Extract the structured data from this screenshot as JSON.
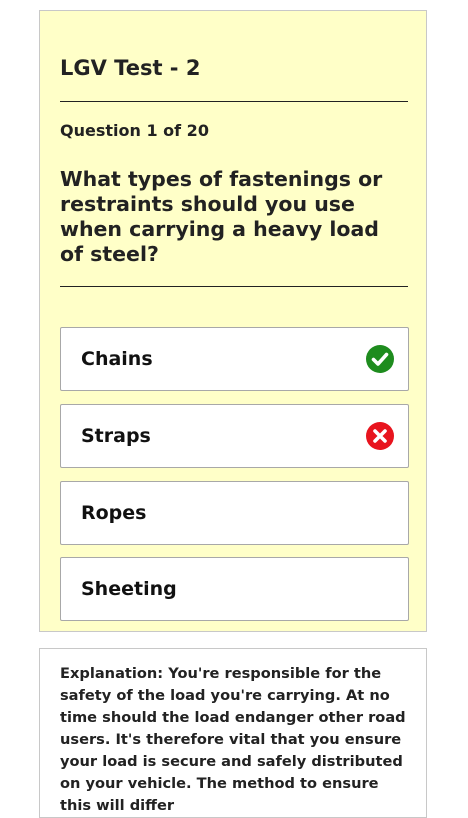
{
  "quiz": {
    "title": "LGV Test - 2",
    "question_number": "Question 1 of 20",
    "question": "What types of fastenings or restraints should you use when carrying a heavy load of steel?",
    "options": [
      {
        "label": "Chains",
        "state": "correct",
        "icon": "check-circle-icon",
        "icon_color": "#1e8c1e"
      },
      {
        "label": "Straps",
        "state": "incorrect",
        "icon": "x-circle-icon",
        "icon_color": "#e8141e"
      },
      {
        "label": "Ropes",
        "state": "none"
      },
      {
        "label": "Sheeting",
        "state": "none"
      }
    ]
  },
  "explanation": {
    "text": "Explanation: You're responsible for the safety of the load you're carrying. At no time should the load endanger other road users. It's therefore vital that you ensure your load is secure and safely distributed on your vehicle. The method to ensure this will differ"
  },
  "colors": {
    "card_background": "#ffffc8",
    "correct": "#1e8c1e",
    "incorrect": "#e8141e"
  }
}
